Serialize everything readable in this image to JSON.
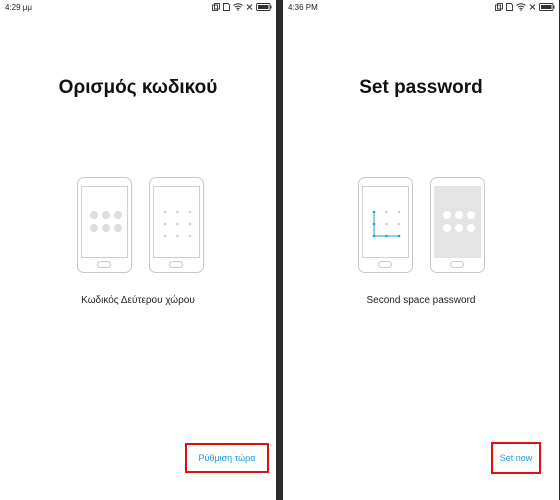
{
  "left": {
    "status_time": "4:29 μμ",
    "title": "Ορισμός κωδικού",
    "subtitle": "Κωδικός Δεύτερου χώρου",
    "button_label": "Ρύθμιση τώρα"
  },
  "right": {
    "status_time": "4:36 PM",
    "title": "Set password",
    "subtitle": "Second space password",
    "button_label": "Set now"
  },
  "colors": {
    "accent": "#1a9ce6",
    "highlight_border": "#e01010",
    "divider": "#2b2b2b"
  },
  "icons": [
    "copy-icon",
    "sim-icon",
    "wifi-icon",
    "cross-icon",
    "battery-icon"
  ]
}
